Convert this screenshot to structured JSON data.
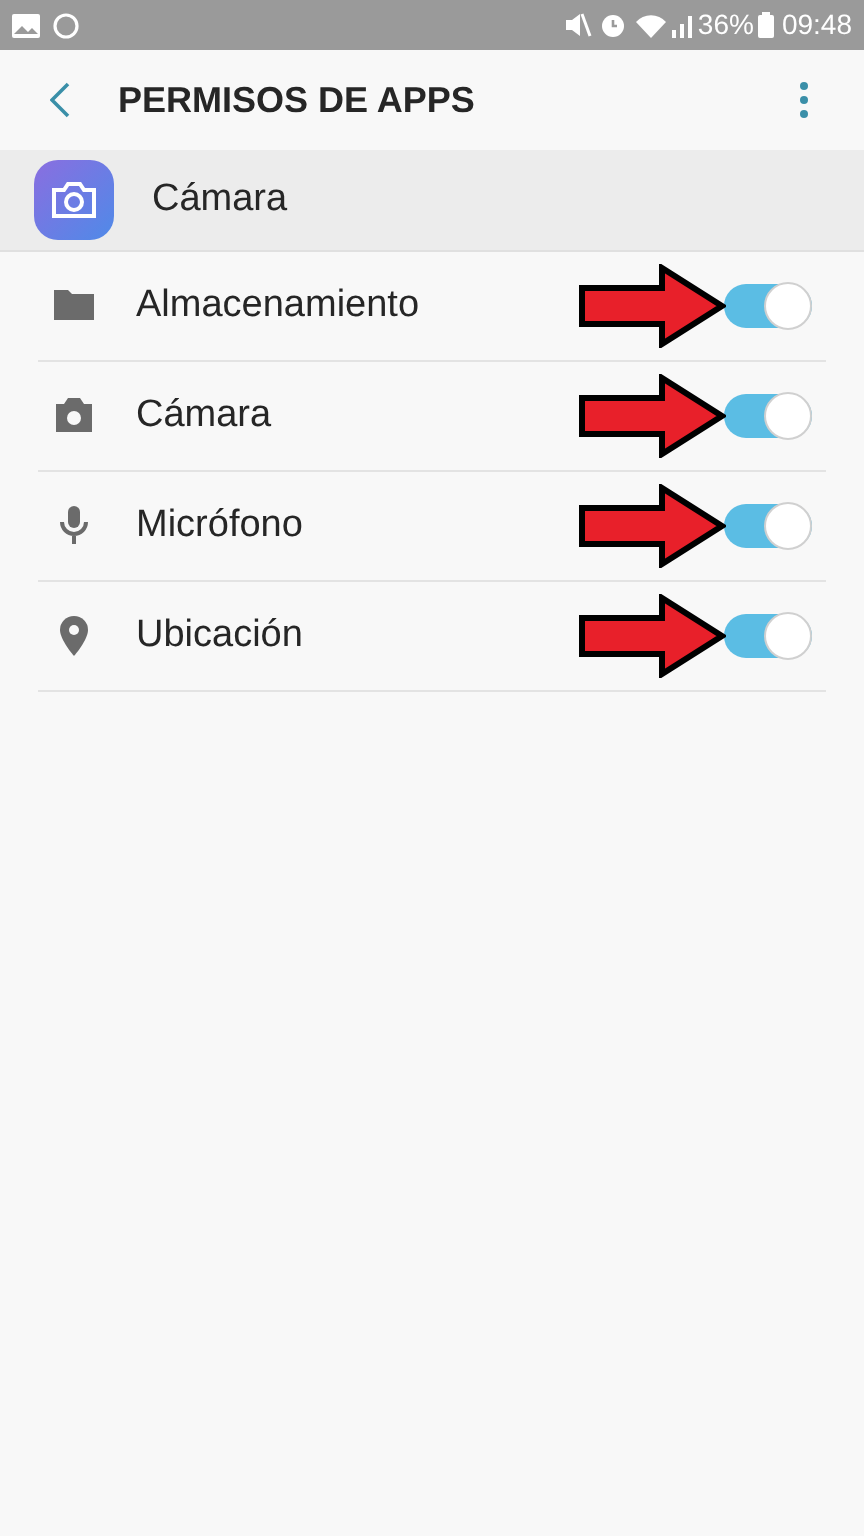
{
  "status_bar": {
    "battery": "36%",
    "time": "09:48"
  },
  "app_bar": {
    "title": "PERMISOS DE APPS"
  },
  "app": {
    "name": "Cámara"
  },
  "permissions": [
    {
      "kind": "storage",
      "label": "Almacenamiento",
      "on": true,
      "annotated": true
    },
    {
      "kind": "camera",
      "label": "Cámara",
      "on": true,
      "annotated": true
    },
    {
      "kind": "microphone",
      "label": "Micrófono",
      "on": true,
      "annotated": true
    },
    {
      "kind": "location",
      "label": "Ubicación",
      "on": true,
      "annotated": true
    }
  ]
}
